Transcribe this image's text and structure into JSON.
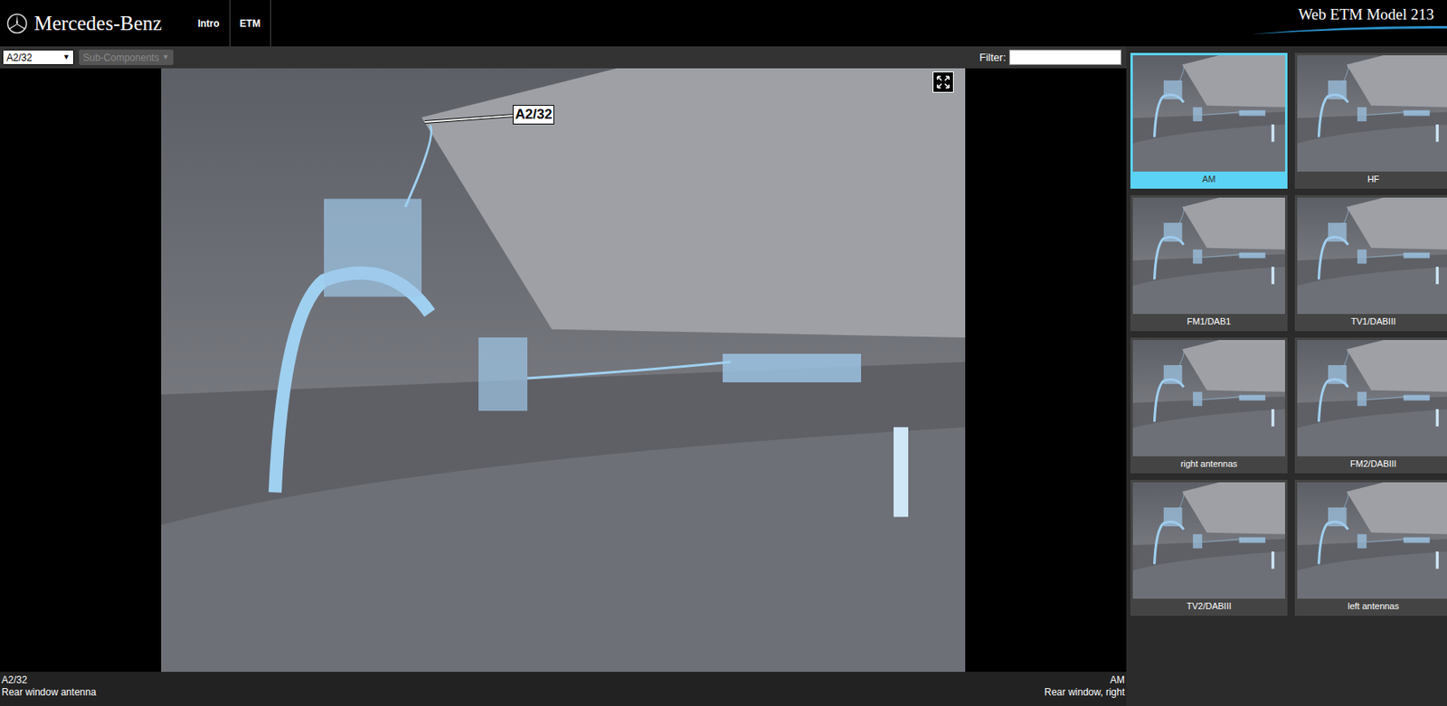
{
  "header": {
    "brand": "Mercedes-Benz",
    "nav": [
      {
        "label": "Intro",
        "selected": false
      },
      {
        "label": "ETM",
        "selected": false
      }
    ],
    "title": "Web ETM Model 213"
  },
  "toolbar": {
    "component_select": "A2/32",
    "subcomponents_select": {
      "label": "Sub-Components",
      "disabled": true
    },
    "filter": {
      "label": "Filter:",
      "value": ""
    }
  },
  "viewer": {
    "callout": "A2/32"
  },
  "status": {
    "component_code": "A2/32",
    "component_name": "Rear window antenna",
    "view_code": "AM",
    "view_name": "Rear window, right"
  },
  "thumbnails": [
    {
      "label": "AM",
      "selected": true
    },
    {
      "label": "HF",
      "selected": false
    },
    {
      "label": "FM1/DAB1",
      "selected": false
    },
    {
      "label": "TV1/DABIII",
      "selected": false
    },
    {
      "label": "right antennas",
      "selected": false
    },
    {
      "label": "FM2/DABIII",
      "selected": false
    },
    {
      "label": "TV2/DABIII",
      "selected": false
    },
    {
      "label": "left antennas",
      "selected": false
    }
  ]
}
